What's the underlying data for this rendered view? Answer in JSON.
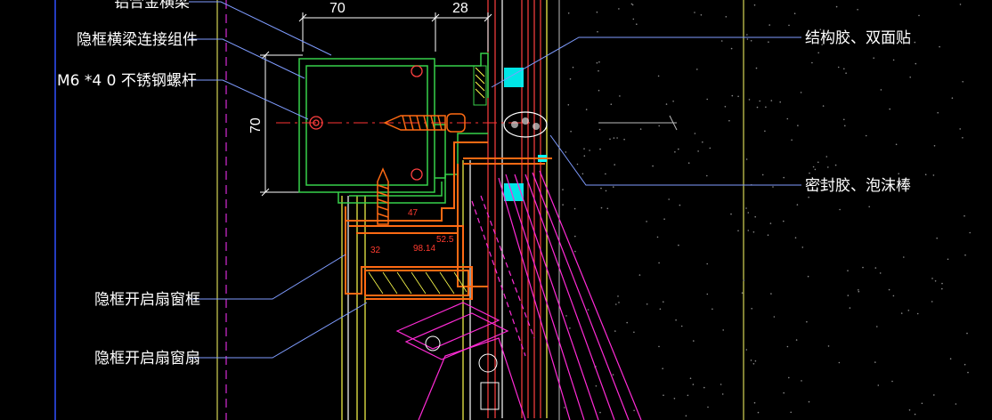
{
  "annotations": {
    "aluminum_beam": "铝合金横梁",
    "beam_connector": "隐框横梁连接组件",
    "bolt": "M6 *4 0 不锈钢螺杆",
    "structural_glue": "结构胶、双面贴",
    "sealant": "密封胶、泡沫棒",
    "sash_frame": "隐框开启扇窗框",
    "sash": "隐框开启扇窗扇"
  },
  "dimensions": {
    "top_left": "70",
    "top_right": "28",
    "vertical": "70",
    "small_a": "32",
    "small_b": "98.14",
    "small_c": "52.5",
    "small_d": "47"
  },
  "colors": {
    "background": "#000000",
    "leader": "#7f9cff",
    "profile": "#37d14a",
    "sash": "#ff6a13",
    "glass": "#ff2bd6",
    "frame_line": "#ffff4d",
    "structure": "#ff3333",
    "insulation": "#00ffff"
  }
}
